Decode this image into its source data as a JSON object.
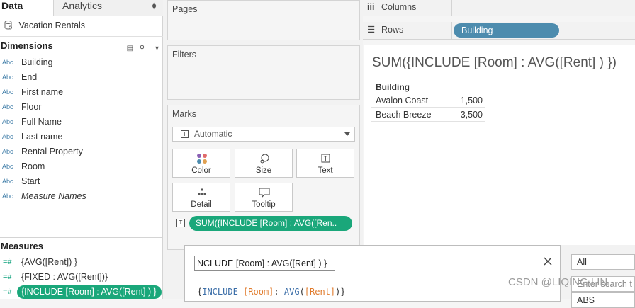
{
  "left_pane": {
    "tabs": {
      "data": "Data",
      "analytics": "Analytics"
    },
    "datasource": "Vacation Rentals",
    "dimensions_header": "Dimensions",
    "dimensions": [
      {
        "type": "Abc",
        "name": "Building"
      },
      {
        "type": "Abc",
        "name": "End"
      },
      {
        "type": "Abc",
        "name": "First name"
      },
      {
        "type": "Abc",
        "name": "Floor"
      },
      {
        "type": "Abc",
        "name": "Full Name"
      },
      {
        "type": "Abc",
        "name": "Last name"
      },
      {
        "type": "Abc",
        "name": "Rental Property"
      },
      {
        "type": "Abc",
        "name": "Room"
      },
      {
        "type": "Abc",
        "name": "Start"
      },
      {
        "type": "Abc",
        "name": "Measure Names"
      }
    ],
    "measures_header": "Measures",
    "measures": [
      {
        "type": "=#",
        "name": "{AVG([Rent]) }"
      },
      {
        "type": "=#",
        "name": "{FIXED : AVG([Rent])}"
      },
      {
        "type": "=#",
        "name": "{INCLUDE [Room] : AVG([Rent] ) }"
      }
    ]
  },
  "shelves": {
    "pages": "Pages",
    "filters": "Filters",
    "marks": "Marks",
    "mark_type": "Automatic",
    "mark_buttons": [
      "Color",
      "Size",
      "Text",
      "Detail",
      "Tooltip"
    ],
    "mark_pill": "SUM({INCLUDE [Room] : AVG([Ren..",
    "columns_label": "Columns",
    "rows_label": "Rows",
    "row_pill": "Building"
  },
  "view": {
    "title": "SUM({INCLUDE [Room] : AVG([Rent] ) })",
    "table_header": "Building",
    "rows": [
      {
        "building": "Avalon Coast",
        "value": "1,500"
      },
      {
        "building": "Beach Breeze",
        "value": "3,500"
      }
    ]
  },
  "editor": {
    "name_value": "NCLUDE [Room] : AVG([Rent] ) }",
    "code": {
      "open": "{",
      "kw": "INCLUDE",
      "field1": "[Room]",
      "colon": ":",
      "fn": "AVG",
      "field2": "[Rent]",
      "close": ")}"
    }
  },
  "right_mini": {
    "all": "All",
    "search": "Enter search t",
    "abs": "ABS"
  },
  "watermark": "CSDN @LIQING LIN",
  "colors": {
    "measure_green": "#1aa77a",
    "dimension_blue": "#4d8cae",
    "type_blue": "#3b7aa6"
  }
}
